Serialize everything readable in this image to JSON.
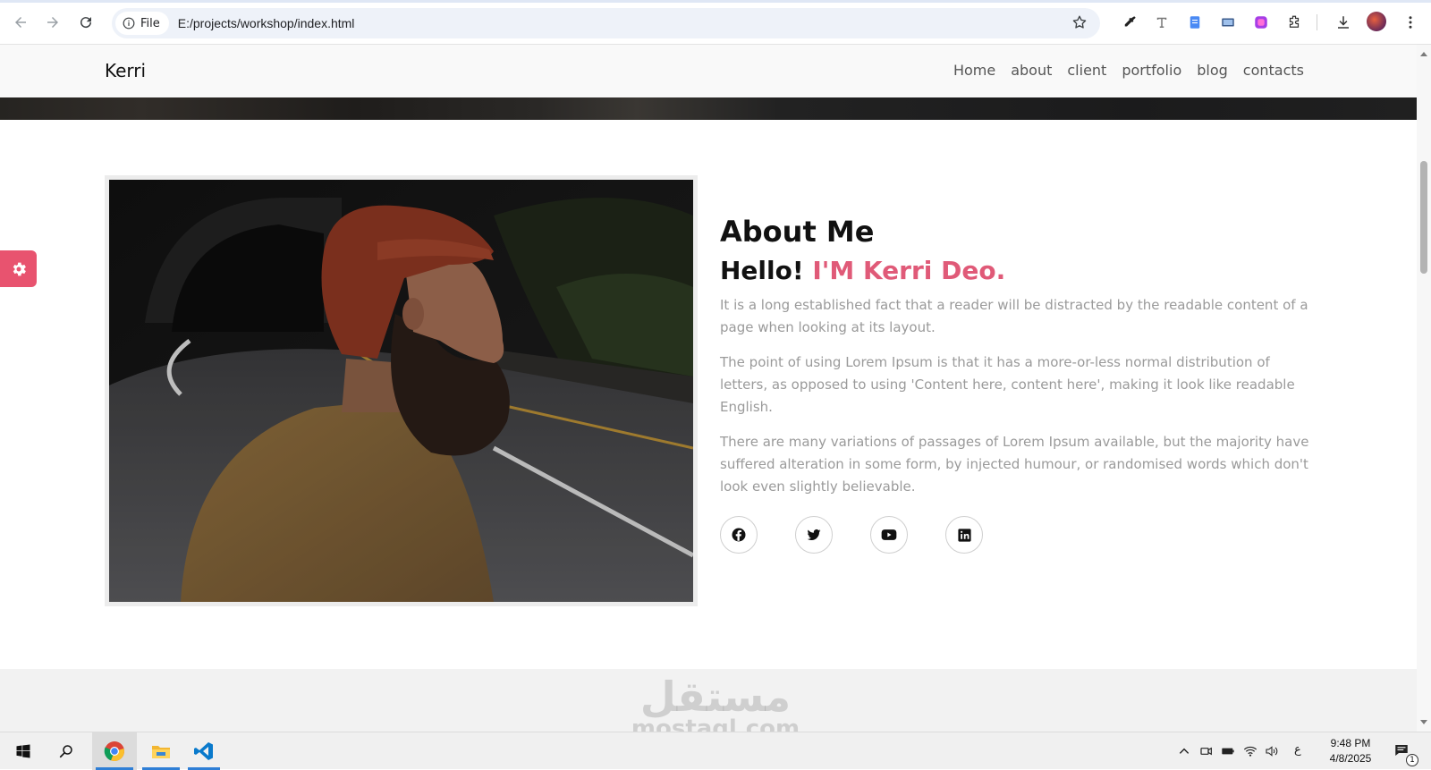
{
  "browser": {
    "file_chip_label": "File",
    "url": "E:/projects/workshop/index.html"
  },
  "site": {
    "brand": "Kerri",
    "menu": [
      {
        "label": "Home"
      },
      {
        "label": "about"
      },
      {
        "label": "client"
      },
      {
        "label": "portfolio"
      },
      {
        "label": "blog"
      },
      {
        "label": "contacts"
      }
    ]
  },
  "about": {
    "title_strong": "About",
    "title_rest": " Me",
    "hello_prefix": "Hello! ",
    "hello_name": "I'M Kerri Deo.",
    "paragraphs": [
      "It is a long established fact that a reader will be distracted by the readable content of a page when looking at its layout.",
      "The point of using Lorem Ipsum is that it has a more-or-less normal distribution of letters, as opposed to using 'Content here, content here', making it look like readable English.",
      "There are many variations of passages of Lorem Ipsum available, but the majority have suffered alteration in some form, by injected humour, or randomised words which don't look even slightly believable."
    ],
    "socials": [
      "facebook-icon",
      "twitter-icon",
      "youtube-icon",
      "linkedin-icon"
    ]
  },
  "watermark": {
    "arabic": "مستقل",
    "latin": "mostaql.com"
  },
  "taskbar": {
    "time": "9:48 PM",
    "date": "4/8/2025",
    "language": "ع",
    "notification_count": "1"
  },
  "colors": {
    "accent": "#e05a78",
    "settings_tab": "#e8536f",
    "text_muted": "#9a9a9a"
  }
}
